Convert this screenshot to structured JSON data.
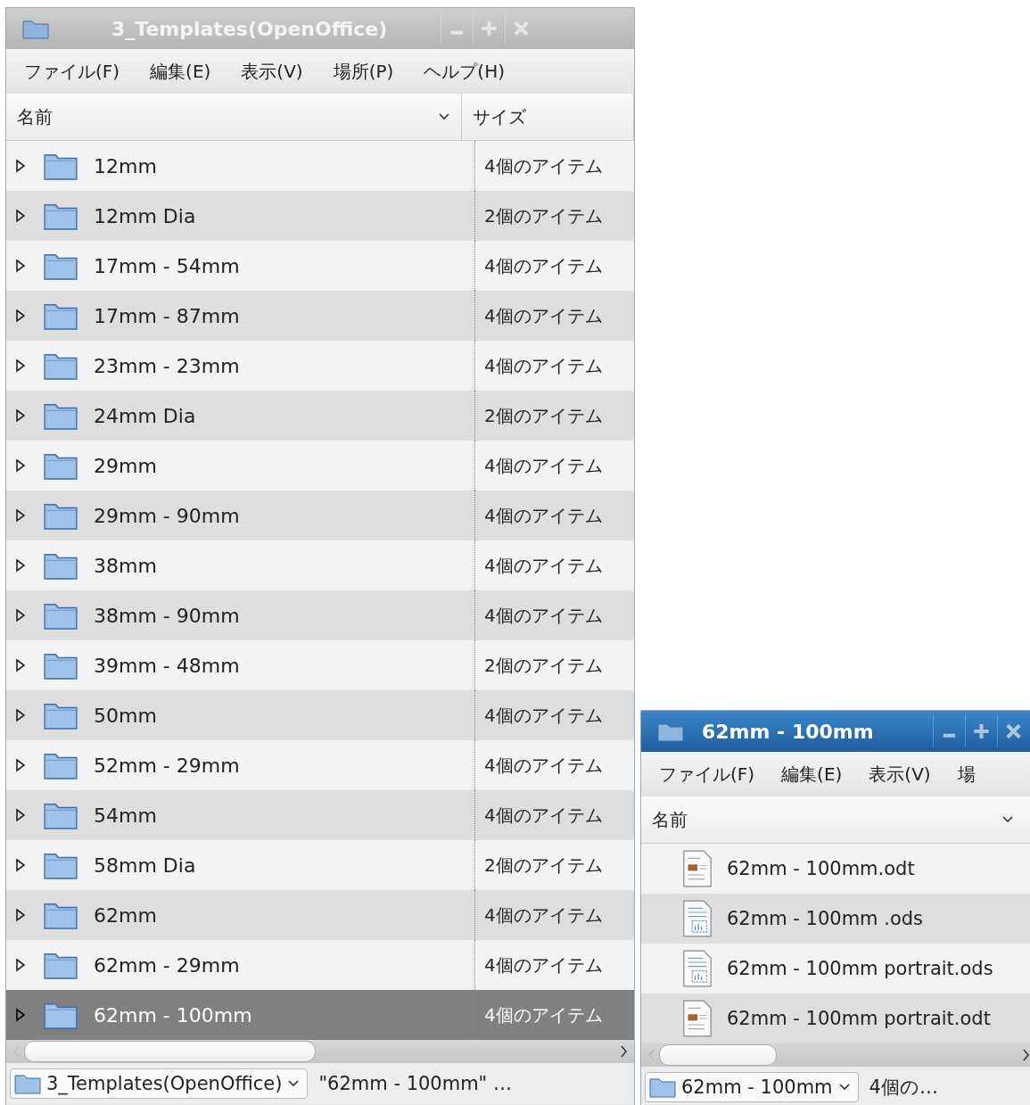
{
  "windows": [
    {
      "title": "3_Templates(OpenOffice)",
      "active": false,
      "menu": [
        "ファイル(F)",
        "編集(E)",
        "表示(V)",
        "場所(P)",
        "ヘルプ(H)"
      ],
      "columns": [
        "名前",
        "サイズ"
      ],
      "rows": [
        {
          "name": "12mm",
          "size": "4個のアイテム",
          "selected": false
        },
        {
          "name": "12mm Dia",
          "size": "2個のアイテム",
          "selected": false
        },
        {
          "name": "17mm - 54mm",
          "size": "4個のアイテム",
          "selected": false
        },
        {
          "name": "17mm - 87mm",
          "size": "4個のアイテム",
          "selected": false
        },
        {
          "name": "23mm - 23mm",
          "size": "4個のアイテム",
          "selected": false
        },
        {
          "name": "24mm Dia",
          "size": "2個のアイテム",
          "selected": false
        },
        {
          "name": "29mm",
          "size": "4個のアイテム",
          "selected": false
        },
        {
          "name": "29mm - 90mm",
          "size": "4個のアイテム",
          "selected": false
        },
        {
          "name": "38mm",
          "size": "4個のアイテム",
          "selected": false
        },
        {
          "name": "38mm - 90mm",
          "size": "4個のアイテム",
          "selected": false
        },
        {
          "name": "39mm - 48mm",
          "size": "2個のアイテム",
          "selected": false
        },
        {
          "name": "50mm",
          "size": "4個のアイテム",
          "selected": false
        },
        {
          "name": "52mm - 29mm",
          "size": "4個のアイテム",
          "selected": false
        },
        {
          "name": "54mm",
          "size": "4個のアイテム",
          "selected": false
        },
        {
          "name": "58mm Dia",
          "size": "2個のアイテム",
          "selected": false
        },
        {
          "name": "62mm",
          "size": "4個のアイテム",
          "selected": false
        },
        {
          "name": "62mm - 29mm",
          "size": "4個のアイテム",
          "selected": false
        },
        {
          "name": "62mm - 100mm",
          "size": "4個のアイテム",
          "selected": true
        }
      ],
      "status": {
        "location": "3_Templates(OpenOffice)",
        "info": "\"62mm - 100mm\" …"
      }
    },
    {
      "title": "62mm - 100mm",
      "active": true,
      "menu": [
        "ファイル(F)",
        "編集(E)",
        "表示(V)",
        "場"
      ],
      "columns": [
        "名前"
      ],
      "rows": [
        {
          "name": "62mm - 100mm.odt",
          "kind": "text"
        },
        {
          "name": "62mm - 100mm .ods",
          "kind": "sheet"
        },
        {
          "name": "62mm - 100mm portrait.ods",
          "kind": "sheet"
        },
        {
          "name": "62mm - 100mm portrait.odt",
          "kind": "text"
        }
      ],
      "status": {
        "location": "62mm - 100mm",
        "info": "4個の…"
      }
    }
  ]
}
